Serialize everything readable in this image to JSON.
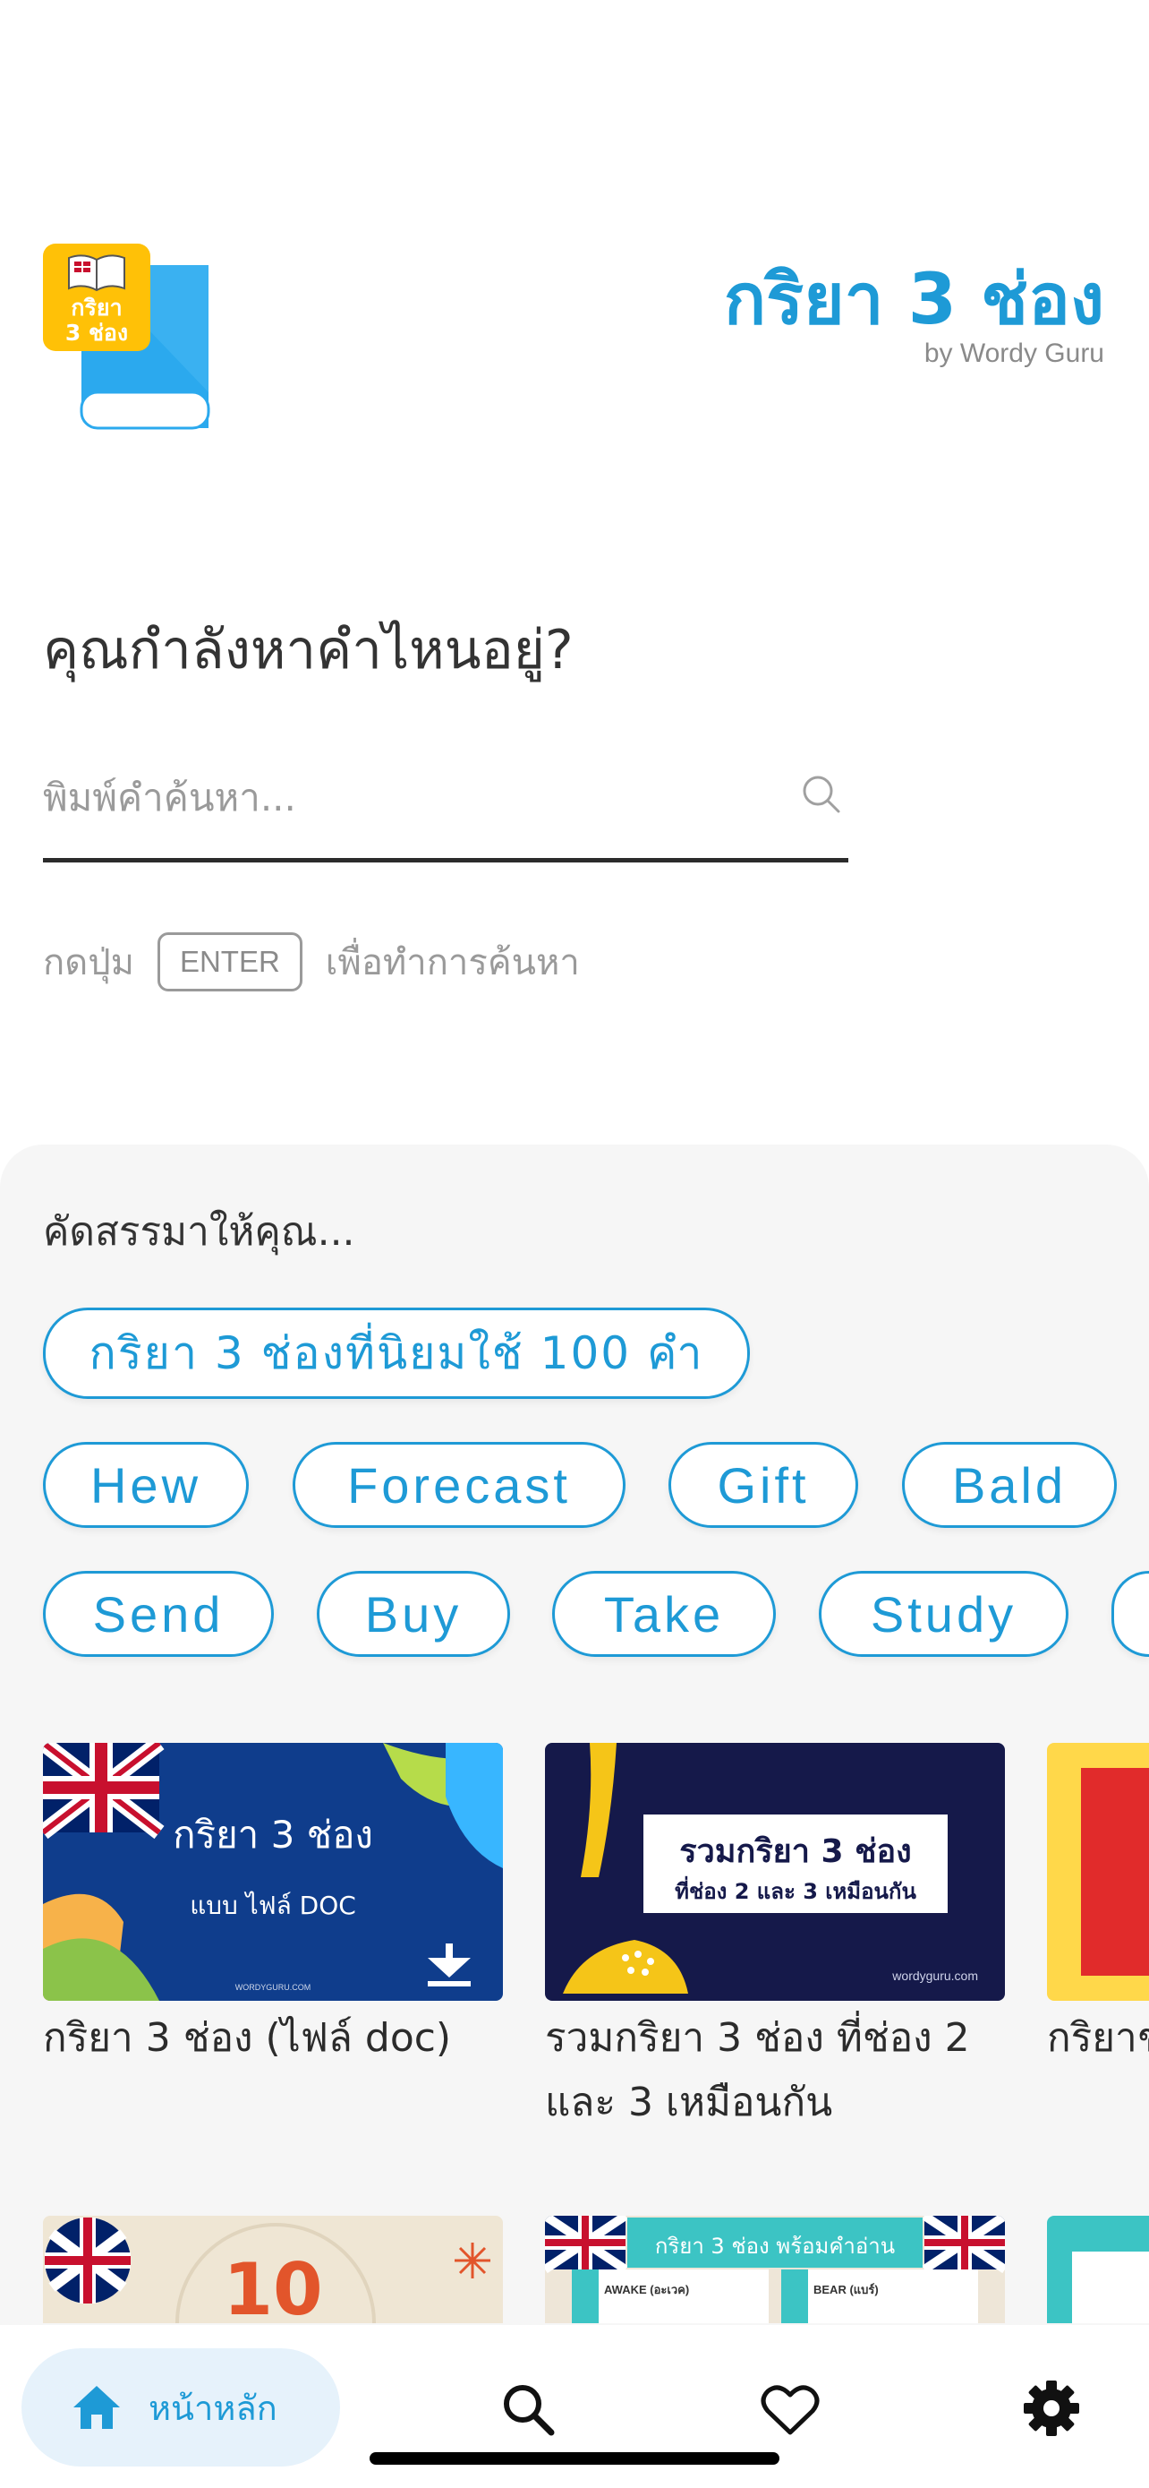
{
  "logo": {
    "badge_line1": "กริยา",
    "badge_line2": "3 ช่อง"
  },
  "header": {
    "title": "กริยา 3 ช่อง",
    "subtitle": "by Wordy Guru"
  },
  "search": {
    "question": "คุณกำลังหาคำไหนอยู่?",
    "placeholder": "พิมพ์คำค้นหา...",
    "hint_prefix": "กดปุ่ม",
    "hint_key": "ENTER",
    "hint_suffix": "เพื่อทำการค้นหา"
  },
  "suggest": {
    "title": "คัดสรรมาให้คุณ...",
    "featured_chip": "กริยา 3 ช่องที่นิยมใช้ 100 คำ",
    "row1": [
      "Hew",
      "Forecast",
      "Gift",
      "Bald"
    ],
    "row2": [
      "Send",
      "Buy",
      "Take",
      "Study"
    ]
  },
  "cards": [
    {
      "title": "กริยา 3 ช่อง (ไฟล์ doc)",
      "img_title": "กริยา 3 ช่อง",
      "img_sub": "แบบ ไฟล์ DOC",
      "img_footer": "WORDYGURU.COM"
    },
    {
      "title": "รวมกริยา 3 ช่อง ที่ช่อง 2 และ 3 เหมือนกัน",
      "img_title": "รวมกริยา 3 ช่อง",
      "img_sub": "ที่ช่อง 2 และ 3 เหมือนกัน",
      "img_footer": "wordyguru.com"
    },
    {
      "title": "กริยาช ความห"
    }
  ],
  "cards_row2": [
    {
      "img_title": "10"
    },
    {
      "img_title": "กริยา 3 ช่อง พร้อมคำอ่าน",
      "left_head": "AWAKE (อะเวค)",
      "right_head": "BEAR (แบร์)"
    }
  ],
  "nav": {
    "home_label": "หน้าหลัก",
    "icons": [
      "home-icon",
      "search-icon",
      "heart-icon",
      "gear-icon"
    ]
  },
  "colors": {
    "accent": "#1e9ad6",
    "badge": "#ffc107",
    "panel": "#f6f6f6"
  }
}
